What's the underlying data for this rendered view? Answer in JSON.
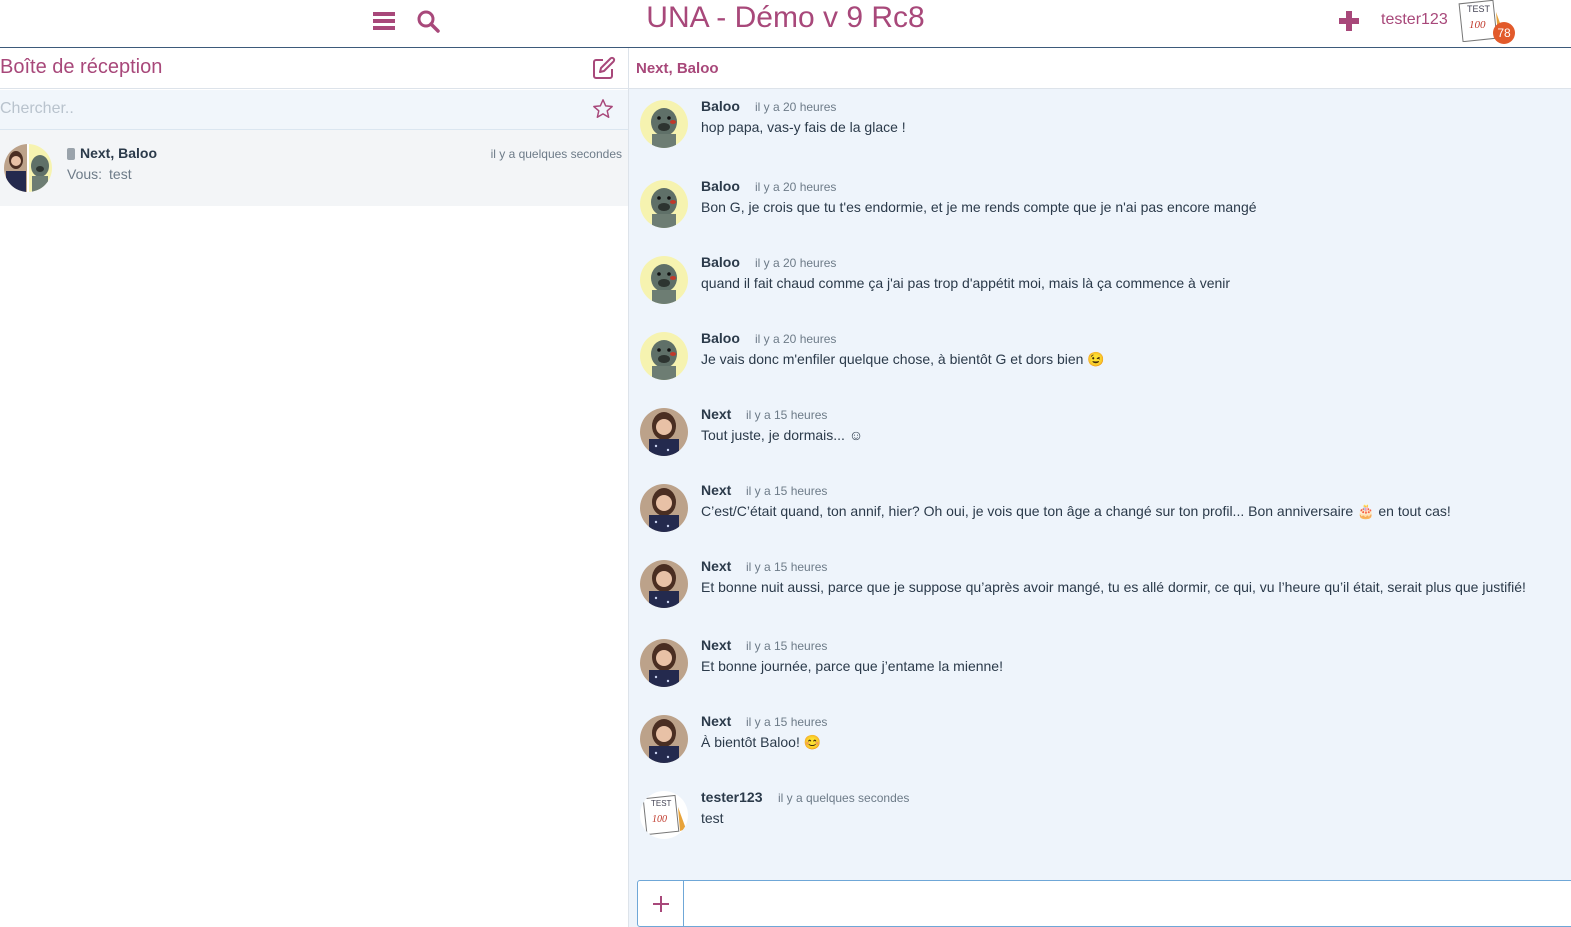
{
  "header": {
    "site_title": "UNA - Démo v 9 Rc8",
    "username": "tester123",
    "notification_count": "78",
    "menu_icon": "hamburger-menu-icon",
    "search_icon": "search-icon",
    "add_icon": "plus-icon"
  },
  "sidebar": {
    "title": "Boîte de réception",
    "compose_icon": "compose-icon",
    "search_placeholder": "Chercher..",
    "star_icon": "star-icon",
    "conversations": [
      {
        "participants": "Next, Baloo",
        "time": "il y a quelques secondes",
        "preview_author": "Vous:",
        "preview_text": "test"
      }
    ]
  },
  "thread": {
    "title": "Next, Baloo",
    "messages": [
      {
        "author": "Baloo",
        "time": "il y a 20 heures",
        "text": "hop papa, vas-y fais de la glace !"
      },
      {
        "author": "Baloo",
        "time": "il y a 20 heures",
        "text": "Bon G, je crois que tu t'es endormie, et je me rends compte que je n'ai pas encore mangé"
      },
      {
        "author": "Baloo",
        "time": "il y a 20 heures",
        "text": "quand il fait chaud comme ça j'ai pas trop d'appétit moi, mais là ça commence à venir"
      },
      {
        "author": "Baloo",
        "time": "il y a 20 heures",
        "text": "Je vais donc m'enfiler quelque chose, à bientôt G et dors bien 😉"
      },
      {
        "author": "Next",
        "time": "il y a 15 heures",
        "text": "Tout juste, je dormais... ☺"
      },
      {
        "author": "Next",
        "time": "il y a 15 heures",
        "text": "C’est/C’était quand, ton annif, hier? Oh oui, je vois que ton âge a changé sur ton profil... Bon anniversaire 🎂 en tout cas!"
      },
      {
        "author": "Next",
        "time": "il y a 15 heures",
        "text": "Et bonne nuit aussi, parce que je suppose qu’après avoir mangé, tu es allé dormir, ce qui, vu l’heure qu’il était, serait plus que justifié!"
      },
      {
        "author": "Next",
        "time": "il y a 15 heures",
        "text": "Et bonne journée, parce que j’entame la mienne!"
      },
      {
        "author": "Next",
        "time": "il y a 15 heures",
        "text": "À bientôt Baloo! 😊"
      },
      {
        "author": "tester123",
        "time": "il y a quelques secondes",
        "text": "test"
      }
    ],
    "composer_add_icon": "plus-icon"
  },
  "colors": {
    "accent": "#a8487a",
    "header_border": "#3d5a7a",
    "thread_bg": "#eef4fb",
    "badge": "#e25a2b"
  }
}
